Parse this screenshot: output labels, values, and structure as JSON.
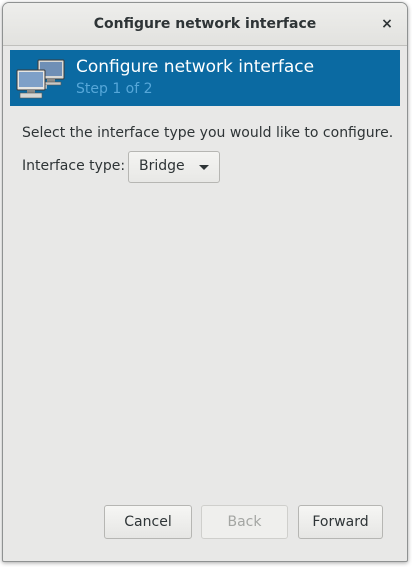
{
  "window": {
    "title": "Configure network interface",
    "close_glyph": "×"
  },
  "banner": {
    "title": "Configure network interface",
    "subtitle": "Step 1 of 2",
    "icon": "network-computers-icon",
    "background": "#0b6aa2",
    "subtitle_color": "#56a7d9"
  },
  "content": {
    "instruction": "Select the interface type you would like to configure.",
    "interface_type_label": "Interface type:",
    "interface_type_value": "Bridge"
  },
  "buttons": {
    "cancel": "Cancel",
    "back": "Back",
    "forward": "Forward"
  }
}
